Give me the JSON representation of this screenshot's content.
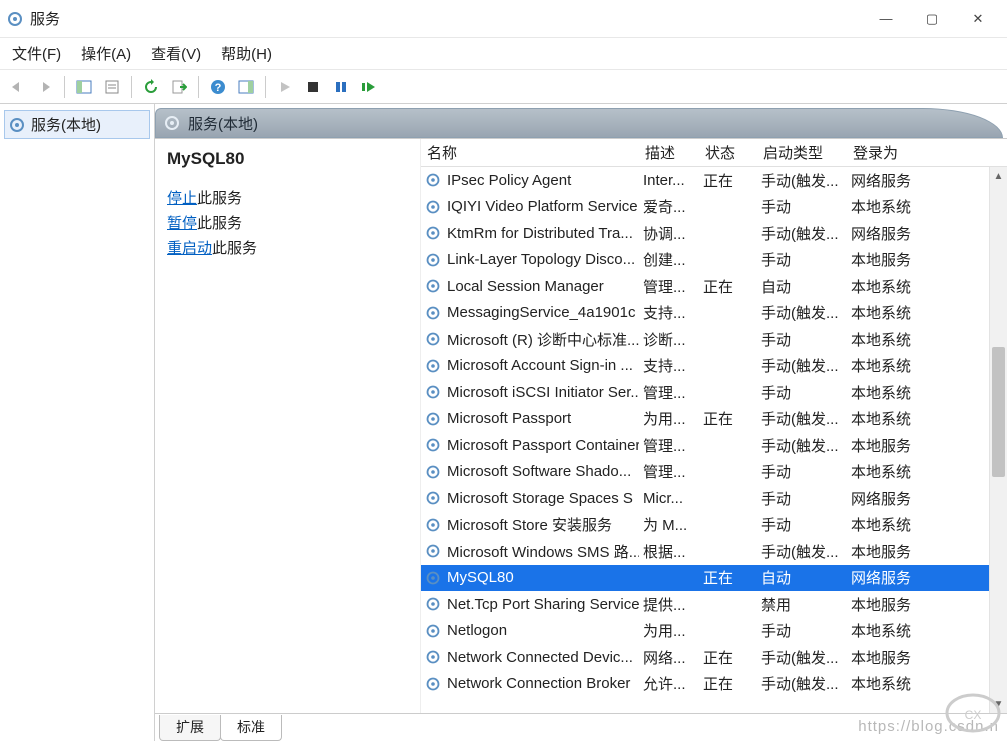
{
  "window": {
    "title": "服务",
    "buttons": {
      "min": "—",
      "max": "▢",
      "close": "✕"
    }
  },
  "menu": {
    "file": "文件(F)",
    "action": "操作(A)",
    "view": "查看(V)",
    "help": "帮助(H)"
  },
  "tree": {
    "root": "服务(本地)"
  },
  "paneHeader": {
    "title": "服务(本地)"
  },
  "detail": {
    "selected_name": "MySQL80",
    "stop_label": "停止",
    "pause_label": "暂停",
    "restart_label": "重启动",
    "tail": "此服务"
  },
  "columns": {
    "name": "名称",
    "desc": "描述",
    "status": "状态",
    "startup": "启动类型",
    "login": "登录为"
  },
  "services": [
    {
      "name": "IPsec Policy Agent",
      "desc": "Inter...",
      "status": "正在",
      "startup": "手动(触发...",
      "login": "网络服务"
    },
    {
      "name": "IQIYI Video Platform Service",
      "desc": "爱奇...",
      "status": "",
      "startup": "手动",
      "login": "本地系统"
    },
    {
      "name": "KtmRm for Distributed Tra...",
      "desc": "协调...",
      "status": "",
      "startup": "手动(触发...",
      "login": "网络服务"
    },
    {
      "name": "Link-Layer Topology Disco...",
      "desc": "创建...",
      "status": "",
      "startup": "手动",
      "login": "本地服务"
    },
    {
      "name": "Local Session Manager",
      "desc": "管理...",
      "status": "正在",
      "startup": "自动",
      "login": "本地系统"
    },
    {
      "name": "MessagingService_4a1901c",
      "desc": "支持...",
      "status": "",
      "startup": "手动(触发...",
      "login": "本地系统"
    },
    {
      "name": "Microsoft (R) 诊断中心标准...",
      "desc": "诊断...",
      "status": "",
      "startup": "手动",
      "login": "本地系统"
    },
    {
      "name": "Microsoft Account Sign-in ...",
      "desc": "支持...",
      "status": "",
      "startup": "手动(触发...",
      "login": "本地系统"
    },
    {
      "name": "Microsoft iSCSI Initiator Ser...",
      "desc": "管理...",
      "status": "",
      "startup": "手动",
      "login": "本地系统"
    },
    {
      "name": "Microsoft Passport",
      "desc": "为用...",
      "status": "正在",
      "startup": "手动(触发...",
      "login": "本地系统"
    },
    {
      "name": "Microsoft Passport Container",
      "desc": "管理...",
      "status": "",
      "startup": "手动(触发...",
      "login": "本地服务"
    },
    {
      "name": "Microsoft Software Shado...",
      "desc": "管理...",
      "status": "",
      "startup": "手动",
      "login": "本地系统"
    },
    {
      "name": "Microsoft Storage Spaces S",
      "desc": "Micr...",
      "status": "",
      "startup": "手动",
      "login": "网络服务"
    },
    {
      "name": "Microsoft Store 安装服务",
      "desc": "为 M...",
      "status": "",
      "startup": "手动",
      "login": "本地系统"
    },
    {
      "name": "Microsoft Windows SMS 路...",
      "desc": "根据...",
      "status": "",
      "startup": "手动(触发...",
      "login": "本地服务"
    },
    {
      "name": "MySQL80",
      "desc": "",
      "status": "正在",
      "startup": "自动",
      "login": "网络服务",
      "selected": true
    },
    {
      "name": "Net.Tcp Port Sharing Service",
      "desc": "提供...",
      "status": "",
      "startup": "禁用",
      "login": "本地服务"
    },
    {
      "name": "Netlogon",
      "desc": "为用...",
      "status": "",
      "startup": "手动",
      "login": "本地系统"
    },
    {
      "name": "Network Connected Devic...",
      "desc": "网络...",
      "status": "正在",
      "startup": "手动(触发...",
      "login": "本地服务"
    },
    {
      "name": "Network Connection Broker",
      "desc": "允许...",
      "status": "正在",
      "startup": "手动(触发...",
      "login": "本地系统"
    }
  ],
  "tabs": {
    "extended": "扩展",
    "standard": "标准"
  },
  "watermark": "https://blog.csdn.n"
}
